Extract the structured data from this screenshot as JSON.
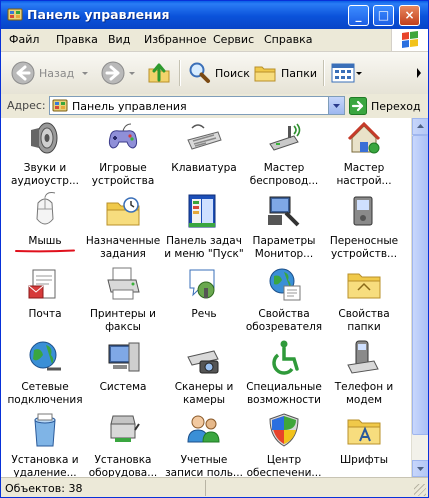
{
  "window": {
    "title": "Панель управления"
  },
  "titlebar": {
    "minimize": "_",
    "maximize": "□",
    "close": "×"
  },
  "menu": [
    "Файл",
    "Правка",
    "Вид",
    "Избранное",
    "Сервис",
    "Справка"
  ],
  "toolbar": {
    "back": "Назад",
    "search": "Поиск",
    "folders": "Папки"
  },
  "address": {
    "label": "Адрес:",
    "value": "Панель управления",
    "go": "Переход"
  },
  "items": [
    {
      "label": "Звуки и\nаудиоустр...",
      "icon": "speaker-icon"
    },
    {
      "label": "Игровые\nустройства",
      "icon": "gamepad-icon"
    },
    {
      "label": "Клавиатура",
      "icon": "keyboard-icon"
    },
    {
      "label": "Мастер\nбеспровод...",
      "icon": "wireless-wizard-icon"
    },
    {
      "label": "Мастер\nнастрой...",
      "icon": "network-wizard-icon"
    },
    {
      "label": "Мышь",
      "icon": "mouse-icon"
    },
    {
      "label": "Назначенные\nзадания",
      "icon": "scheduled-tasks-icon"
    },
    {
      "label": "Панель задач\nи меню \"Пуск\"",
      "icon": "taskbar-icon"
    },
    {
      "label": "Параметры\nМонитор...",
      "icon": "monitor-options-icon"
    },
    {
      "label": "Переносные\nустройств...",
      "icon": "portable-devices-icon"
    },
    {
      "label": "Почта",
      "icon": "mail-icon"
    },
    {
      "label": "Принтеры и\nфаксы",
      "icon": "printer-icon"
    },
    {
      "label": "Речь",
      "icon": "speech-icon"
    },
    {
      "label": "Свойства\nобозревателя",
      "icon": "internet-options-icon"
    },
    {
      "label": "Свойства\nпапки",
      "icon": "folder-options-icon"
    },
    {
      "label": "Сетевые\nподключения",
      "icon": "network-connections-icon"
    },
    {
      "label": "Система",
      "icon": "system-icon"
    },
    {
      "label": "Сканеры и\nкамеры",
      "icon": "scanner-camera-icon"
    },
    {
      "label": "Специальные\nвозможности",
      "icon": "accessibility-icon"
    },
    {
      "label": "Телефон и\nмодем",
      "icon": "phone-modem-icon"
    },
    {
      "label": "Установка и\nудаление...",
      "icon": "add-remove-programs-icon"
    },
    {
      "label": "Установка\nоборудова...",
      "icon": "add-hardware-icon"
    },
    {
      "label": "Учетные\nзаписи поль...",
      "icon": "user-accounts-icon"
    },
    {
      "label": "Центр\nобеспечени...",
      "icon": "security-center-icon"
    },
    {
      "label": "Шрифты",
      "icon": "fonts-icon"
    }
  ],
  "status": {
    "count": "Объектов: 38"
  },
  "colors": {
    "titlebar": "#0a52da",
    "accent_underline": "#e0101c",
    "content_bg": "#ffffff"
  }
}
